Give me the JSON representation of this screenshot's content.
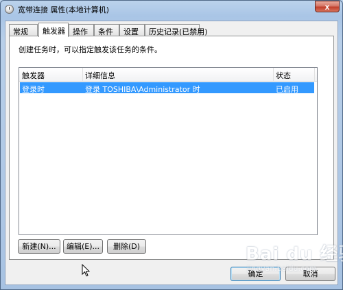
{
  "window": {
    "title": "宽带连接 属性(本地计算机)",
    "close_glyph": "x"
  },
  "tabs": [
    {
      "label": "常规",
      "active": false
    },
    {
      "label": "触发器",
      "active": true
    },
    {
      "label": "操作",
      "active": false
    },
    {
      "label": "条件",
      "active": false
    },
    {
      "label": "设置",
      "active": false
    },
    {
      "label": "历史记录(已禁用)",
      "active": false
    }
  ],
  "triggers": {
    "description": "创建任务时，可以指定触发该任务的条件。",
    "columns": [
      "触发器",
      "详细信息",
      "状态"
    ],
    "rows": [
      {
        "trigger": "登录时",
        "details": "登录 TOSHIBA\\Administrator 时",
        "status": "已启用",
        "selected": true
      }
    ],
    "buttons": {
      "new": "新建(N)...",
      "edit": "编辑(E)...",
      "delete": "删除(D)"
    }
  },
  "footer": {
    "ok": "确定",
    "cancel": "取消"
  },
  "watermark": {
    "brand": "Bai du 经验",
    "url": "jingyan.baidu.com"
  },
  "colors": {
    "selection": "#3399ff",
    "title_bar": "#bcd3ec",
    "close_button": "#c2402c"
  },
  "icons": {
    "title": "clock-icon",
    "close": "close-icon",
    "cursor": "mouse-pointer-icon"
  }
}
